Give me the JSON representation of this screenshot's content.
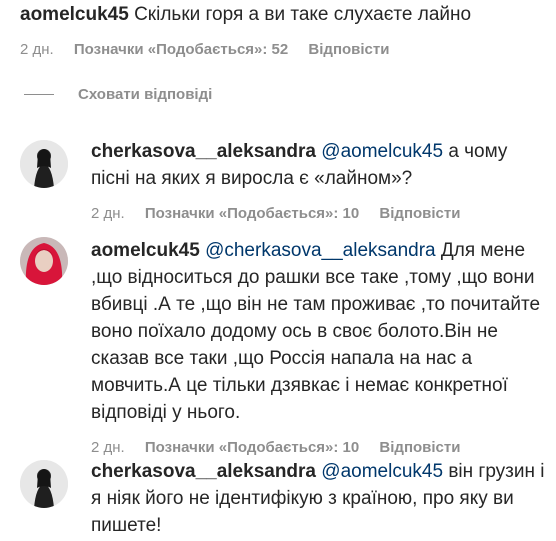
{
  "top_comment": {
    "username": "aomelcuk45",
    "text": "Скільки горя а ви таке слухаєте лайно",
    "time": "2 дн.",
    "likes": "Позначки «Подобається»: 52",
    "reply": "Відповісти"
  },
  "hide_replies": "Сховати відповіді",
  "replies": [
    {
      "username": "cherkasova__aleksandra",
      "mention": "@aomelcuk45",
      "text": "а чому пісні на яких я виросла є «лайном»?",
      "time": "2 дн.",
      "likes": "Позначки «Подобається»: 10",
      "reply": "Відповісти"
    },
    {
      "username": "aomelcuk45",
      "mention": "@cherkasova__aleksandra",
      "text": "Для мене ,що відноситься до рашки все таке ,тому ,що вони вбивці .А те ,що він не там проживає ,то почитайте воно поїхало додому ось в своє болото.Він не сказав все таки ,що Россія напала на нас а мовчить.А це тільки дзявкає і немає конкретної відповіді у нього.",
      "time": "2 дн.",
      "likes": "Позначки «Подобається»: 10",
      "reply": "Відповісти"
    },
    {
      "username": "cherkasova__aleksandra",
      "mention": "@aomelcuk45",
      "text": "він грузин і я ніяк його не ідентифікую з країною, про яку ви пишете!",
      "time": "",
      "likes": "",
      "reply": ""
    }
  ],
  "colors": {
    "text": "#262626",
    "secondary": "#8e8e8e",
    "mention": "#00376b",
    "avatar_red_hair": "#d8153a"
  },
  "icons": [
    "avatar-cherkasova",
    "avatar-aomelcuk45"
  ]
}
